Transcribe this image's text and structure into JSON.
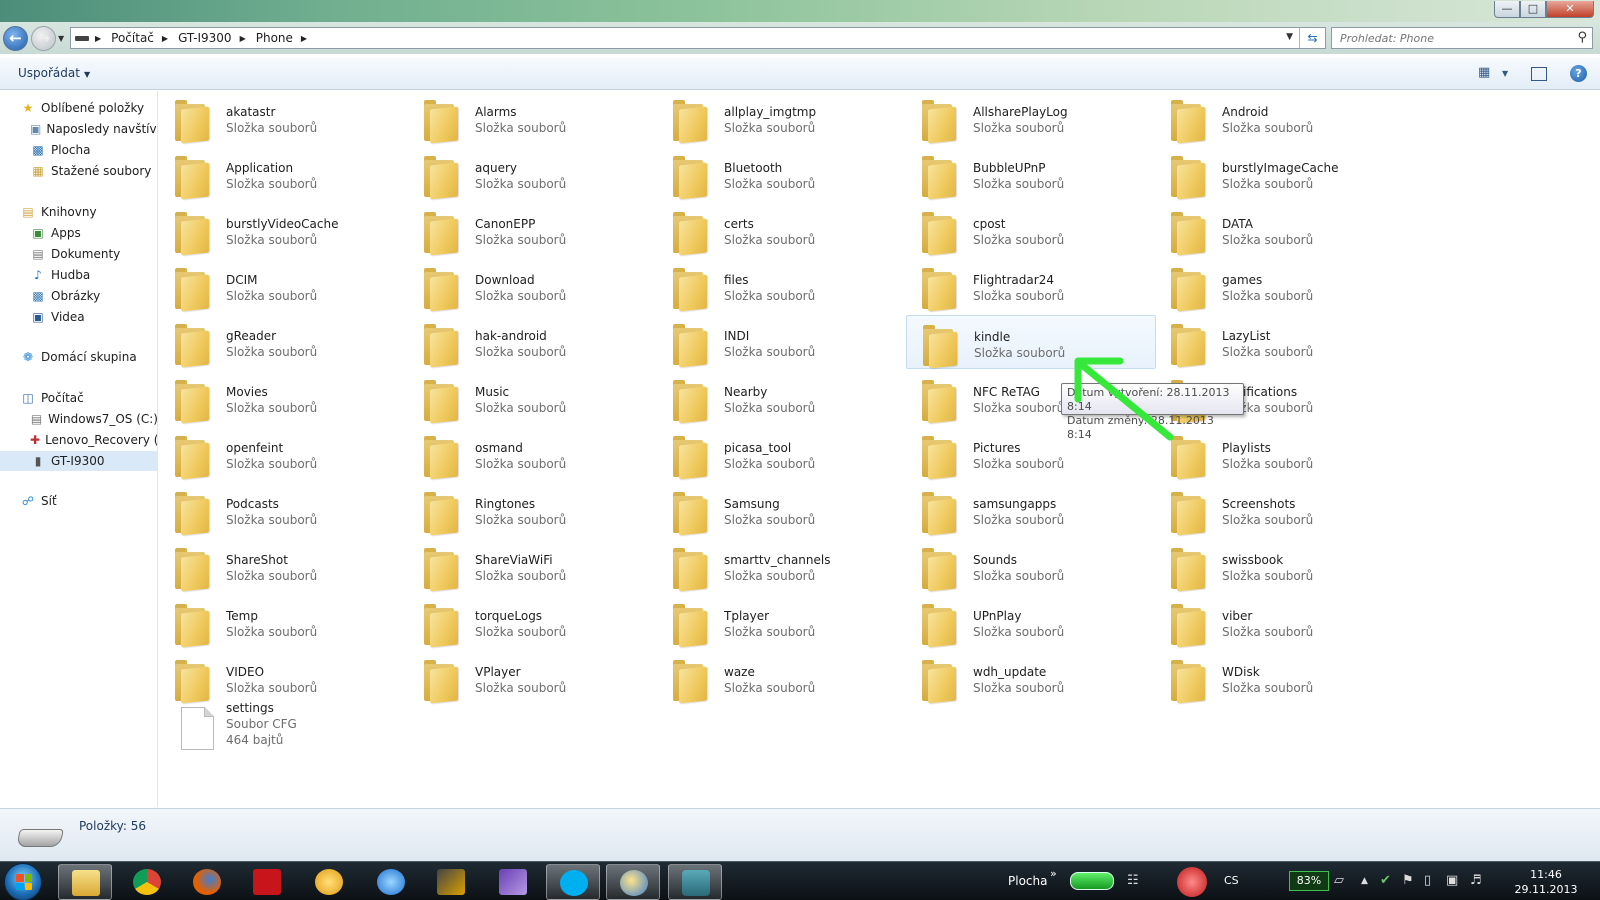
{
  "window": {
    "minimize_glyph": "—",
    "maximize_glyph": "□",
    "close_glyph": "✕"
  },
  "address": {
    "crumbs": [
      "Počítač",
      "GT-I9300",
      "Phone"
    ],
    "search_placeholder": "Prohledat: Phone"
  },
  "toolbar": {
    "organize_label": "Uspořádat"
  },
  "navpane": {
    "favorites": "Oblíbené položky",
    "favorites_items": [
      "Naposledy navštívené",
      "Plocha",
      "Stažené soubory"
    ],
    "libraries": "Knihovny",
    "libraries_items": [
      "Apps",
      "Dokumenty",
      "Hudba",
      "Obrázky",
      "Videa"
    ],
    "homegroup": "Domácí skupina",
    "computer": "Počítač",
    "computer_items": [
      "Windows7_OS (C:)",
      "Lenovo_Recovery (C",
      "GT-I9300"
    ],
    "network": "Síť"
  },
  "folder_type": "Složka souborů",
  "folders": [
    "akatastr",
    "Alarms",
    "allplay_imgtmp",
    "AllsharePlayLog",
    "Android",
    "Application",
    "aquery",
    "Bluetooth",
    "BubbleUPnP",
    "burstlyImageCache",
    "burstlyVideoCache",
    "CanonEPP",
    "certs",
    "cpost",
    "DATA",
    "DCIM",
    "Download",
    "files",
    "Flightradar24",
    "games",
    "gReader",
    "hak-android",
    "INDI",
    "kindle",
    "LazyList",
    "Movies",
    "Music",
    "Nearby",
    "NFC ReTAG",
    "Notifications",
    "openfeint",
    "osmand",
    "picasa_tool",
    "Pictures",
    "Playlists",
    "Podcasts",
    "Ringtones",
    "Samsung",
    "samsungapps",
    "Screenshots",
    "ShareShot",
    "ShareViaWiFi",
    "smarttv_channels",
    "Sounds",
    "swissbook",
    "Temp",
    "torqueLogs",
    "Tplayer",
    "UPnPlay",
    "viber",
    "VIDEO",
    "VPlayer",
    "waze",
    "wdh_update",
    "WDisk"
  ],
  "file": {
    "name": "settings",
    "type": "Soubor CFG",
    "size": "464 bajtů"
  },
  "tooltip": {
    "line1": "Datum vytvoření: 28.11.2013 8:14",
    "line2": "Datum změny: 28.11.2013 8:14"
  },
  "details": {
    "count": "Položky: 56"
  },
  "taskbar": {
    "plocha": "Plocha",
    "chevron": "»",
    "lang": "CS",
    "battery": "83%",
    "time": "11:46",
    "date": "29.11.2013"
  },
  "colors": {
    "accent": "#2a6fb4",
    "arrow": "#36e83a",
    "folder": "#efc95c"
  }
}
